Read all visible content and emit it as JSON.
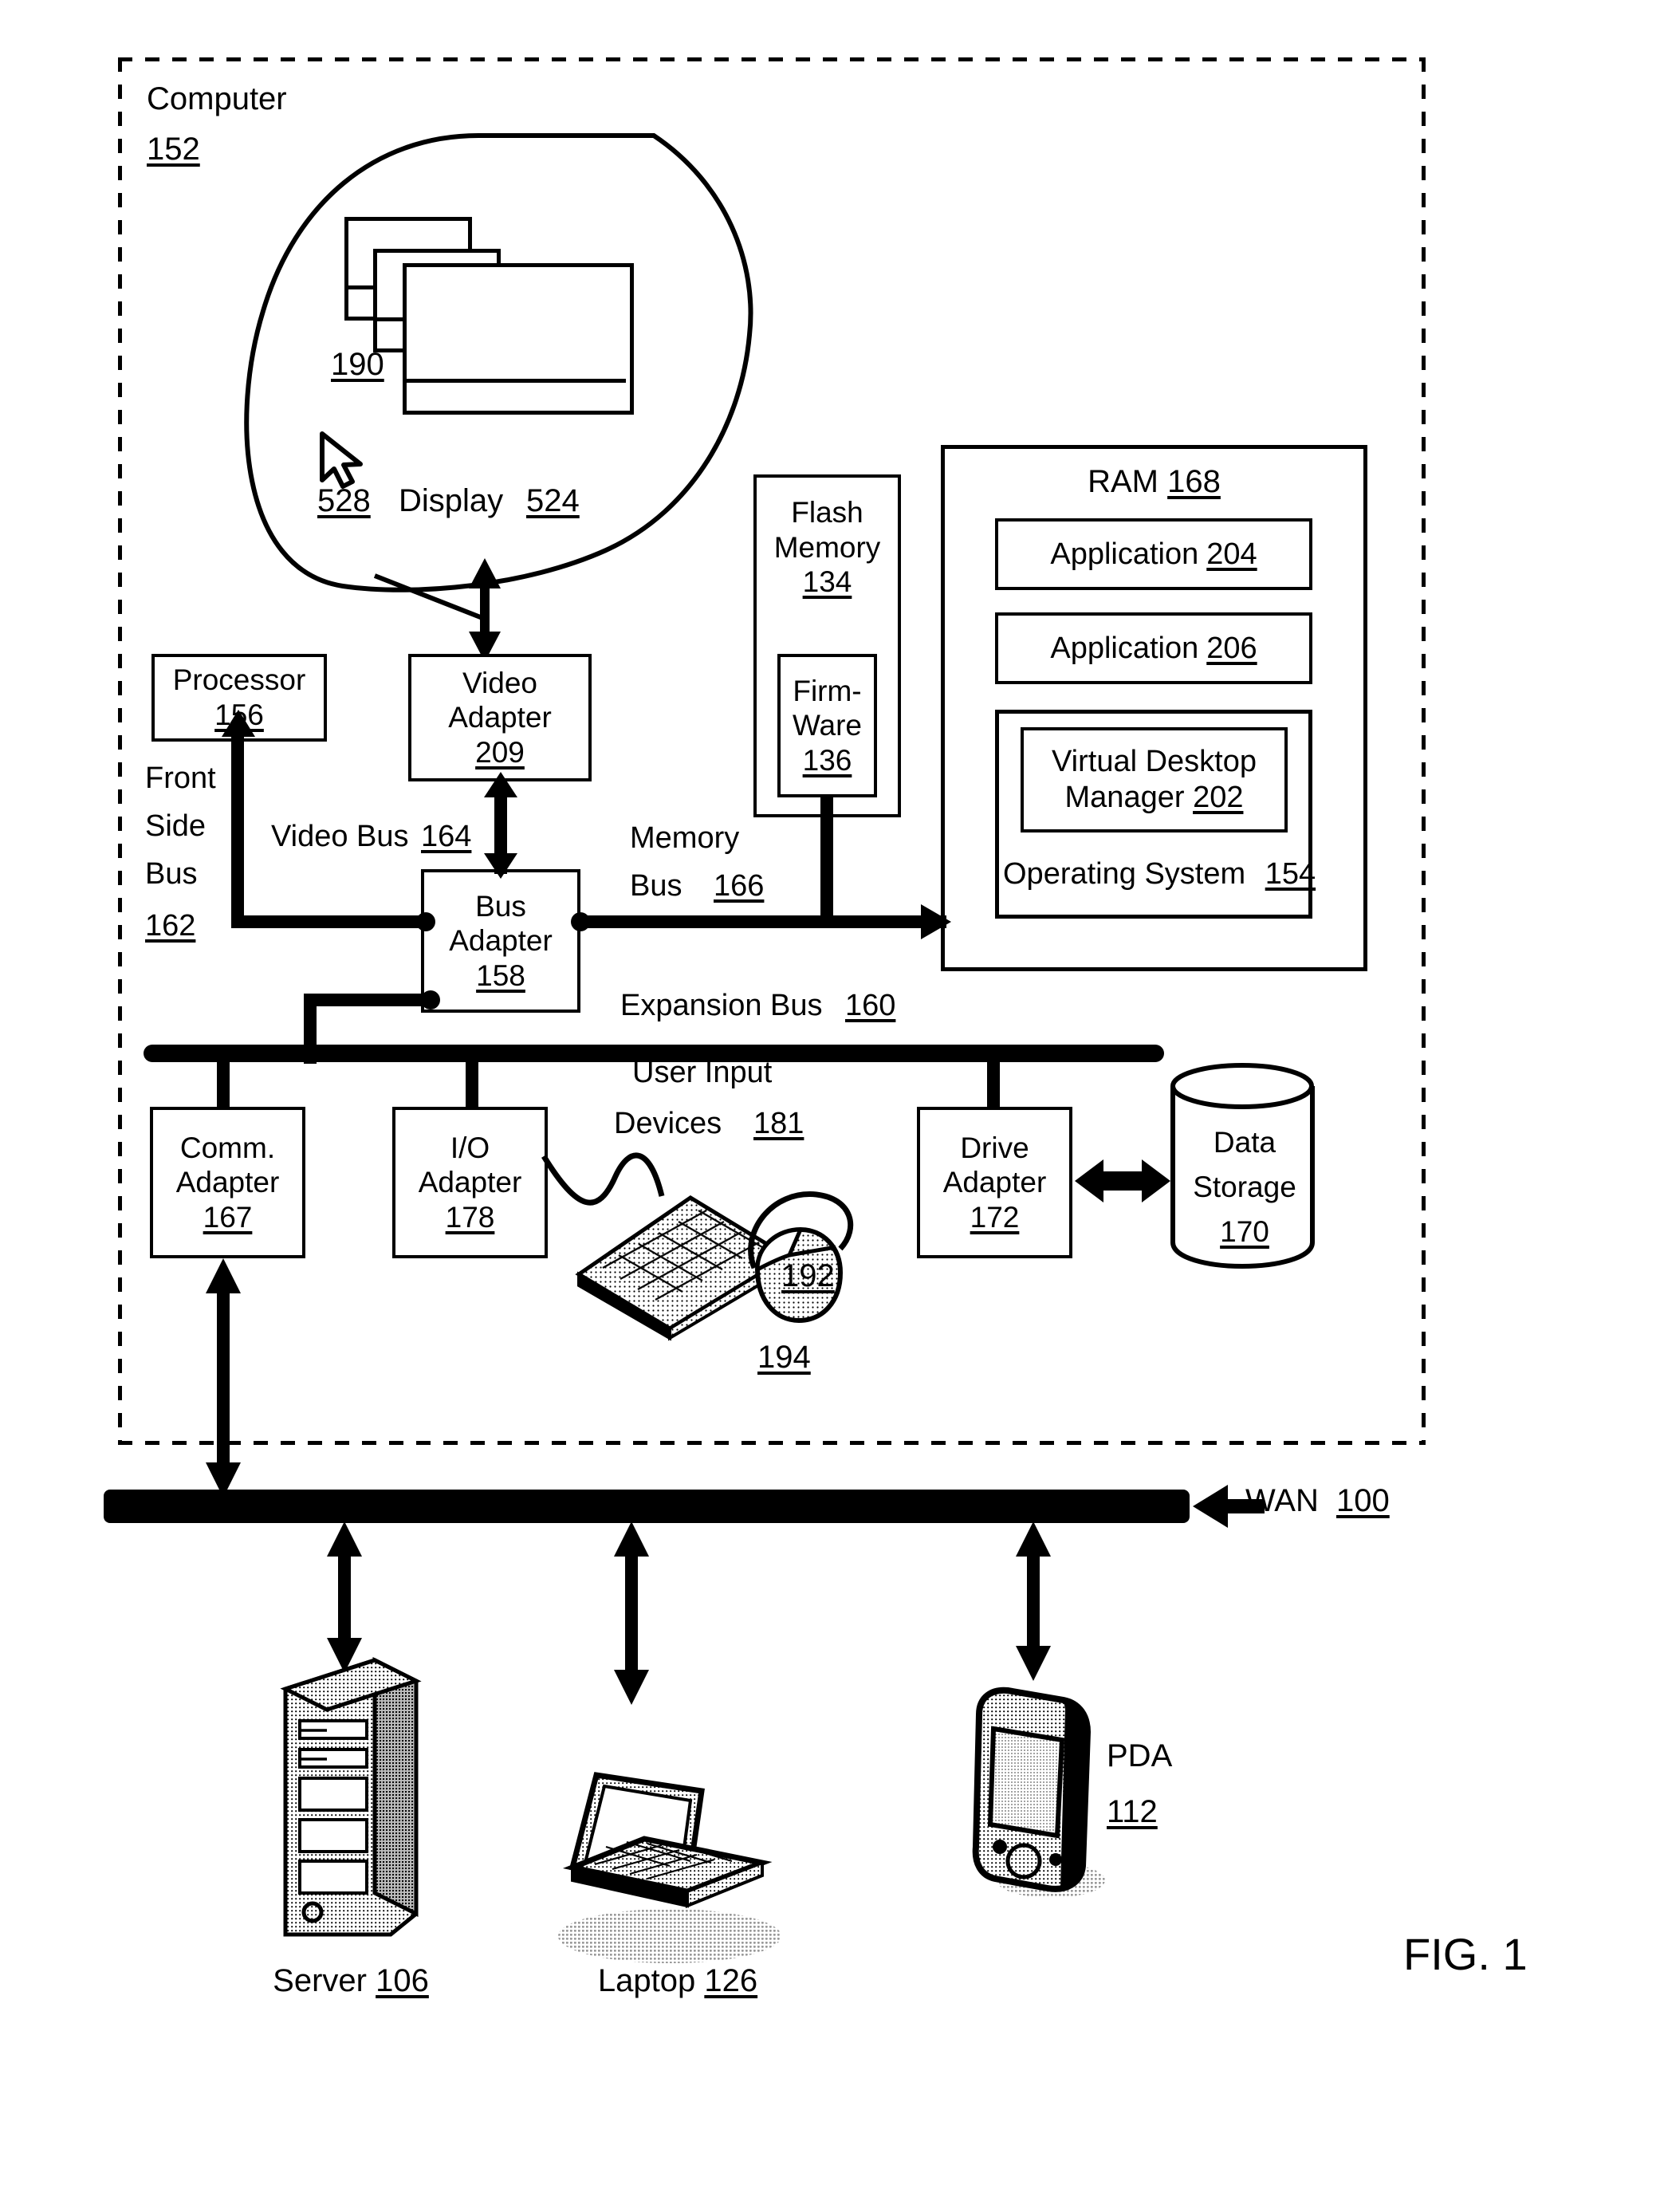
{
  "figure": {
    "label": "FIG. 1"
  },
  "enclosure": {
    "title": "Computer",
    "ref": "152"
  },
  "display": {
    "windows_ref": "190",
    "cursor_ref": "528",
    "label": "Display",
    "ref": "524"
  },
  "components": {
    "processor": {
      "line1": "Processor",
      "ref": "156"
    },
    "video_adapter": {
      "line1": "Video",
      "line2": "Adapter",
      "ref": "209"
    },
    "bus_adapter": {
      "line1": "Bus",
      "line2": "Adapter",
      "ref": "158"
    },
    "flash_memory": {
      "line1": "Flash",
      "line2": "Memory",
      "ref": "134"
    },
    "firmware": {
      "line1": "Firm-",
      "line2": "Ware",
      "ref": "136"
    },
    "comm_adapter": {
      "line1": "Comm.",
      "line2": "Adapter",
      "ref": "167"
    },
    "io_adapter": {
      "line1": "I/O",
      "line2": "Adapter",
      "ref": "178"
    },
    "drive_adapter": {
      "line1": "Drive",
      "line2": "Adapter",
      "ref": "172"
    },
    "data_storage": {
      "line1": "Data",
      "line2": "Storage",
      "ref": "170"
    }
  },
  "ram": {
    "title": "RAM",
    "ref": "168",
    "items": [
      {
        "label": "Application",
        "ref": "204"
      },
      {
        "label": "Application",
        "ref": "206"
      }
    ],
    "virtual_desktop_manager": {
      "line1": "Virtual Desktop",
      "line2": "Manager",
      "ref": "202"
    },
    "operating_system": {
      "label": "Operating System",
      "ref": "154"
    }
  },
  "buses": {
    "front_side_bus": {
      "l1": "Front",
      "l2": "Side",
      "l3": "Bus",
      "ref": "162"
    },
    "video_bus": {
      "label": "Video Bus",
      "ref": "164"
    },
    "memory_bus": {
      "l1": "Memory",
      "l2": "Bus",
      "ref": "166"
    },
    "expansion_bus": {
      "label": "Expansion Bus",
      "ref": "160"
    },
    "wan": {
      "label": "WAN",
      "ref": "100"
    }
  },
  "user_input": {
    "l1": "User Input",
    "l2": "Devices",
    "ref": "181",
    "keyboard_ref": "192",
    "mouse_ref": "194"
  },
  "network_devices": [
    {
      "label": "Server",
      "ref": "106"
    },
    {
      "label": "Laptop",
      "ref": "126"
    },
    {
      "label": "PDA",
      "ref": "112"
    }
  ]
}
